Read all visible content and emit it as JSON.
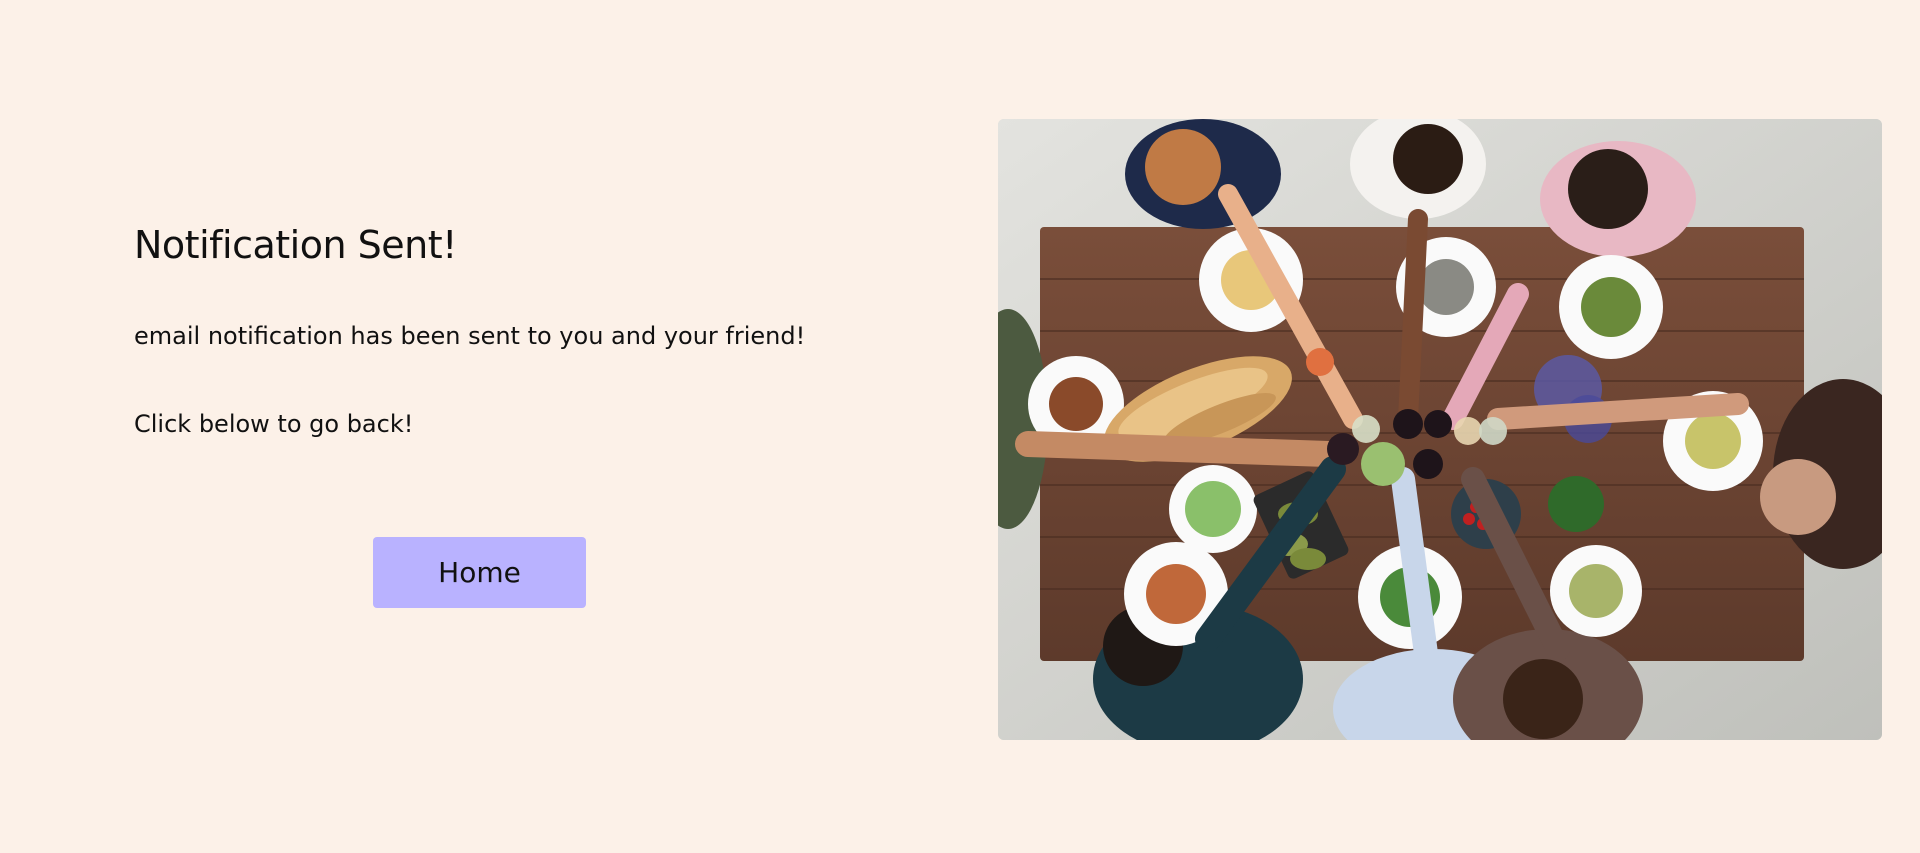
{
  "main": {
    "title": "Notification Sent!",
    "message": "email notification has been sent to you and your friend!",
    "back_prompt": "Click below to go back!",
    "home_button_label": "Home"
  },
  "image": {
    "alt": "Overhead view of friends toasting around a dinner table"
  },
  "colors": {
    "background": "#fcf1e8",
    "button": "#b9b2ff",
    "text": "#111111"
  }
}
